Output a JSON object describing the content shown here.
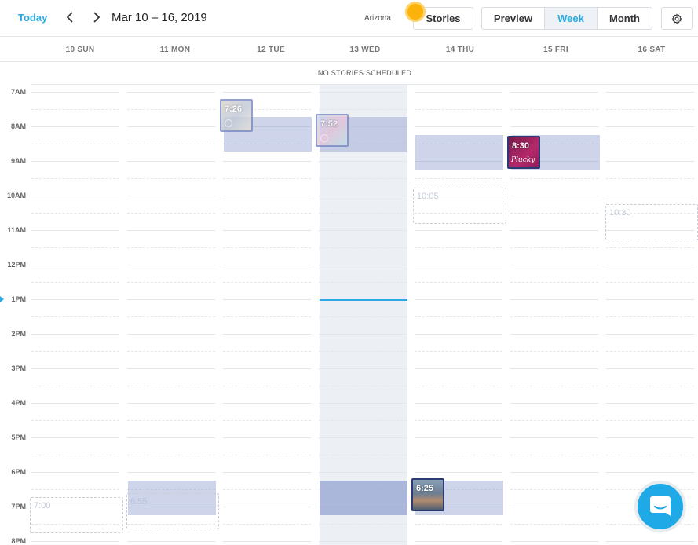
{
  "toolbar": {
    "today_label": "Today",
    "prev_icon": "chevron-left-icon",
    "next_icon": "chevron-right-icon",
    "date_range": "Mar 10 – 16, 2019",
    "timezone": "Arizona",
    "stories_label": "Stories",
    "view_preview": "Preview",
    "view_week": "Week",
    "view_month": "Month",
    "selected_view": "Week",
    "settings_icon": "gear-icon",
    "accent_color": "#2aa9e0"
  },
  "days": [
    {
      "label": "10 SUN"
    },
    {
      "label": "11 MON"
    },
    {
      "label": "12 TUE"
    },
    {
      "label": "13 WED"
    },
    {
      "label": "14 THU"
    },
    {
      "label": "15 FRI"
    },
    {
      "label": "16 SAT"
    }
  ],
  "no_stories": "NO STORIES SCHEDULED",
  "hours": [
    "7AM",
    "8AM",
    "9AM",
    "10AM",
    "11AM",
    "12PM",
    "1PM",
    "2PM",
    "3PM",
    "4PM",
    "5PM",
    "6PM",
    "7PM",
    "8PM"
  ],
  "posts": {
    "tue_time": "7:26",
    "wed_time": "7:52",
    "fri_time": "8:30",
    "fri_caption": "Plucky",
    "thu_time": "6:25"
  },
  "ghosts": {
    "sun": "7:00",
    "mon": "6:55",
    "thu": "10:05",
    "sat": "10:30"
  },
  "chat_icon": "chat-icon"
}
